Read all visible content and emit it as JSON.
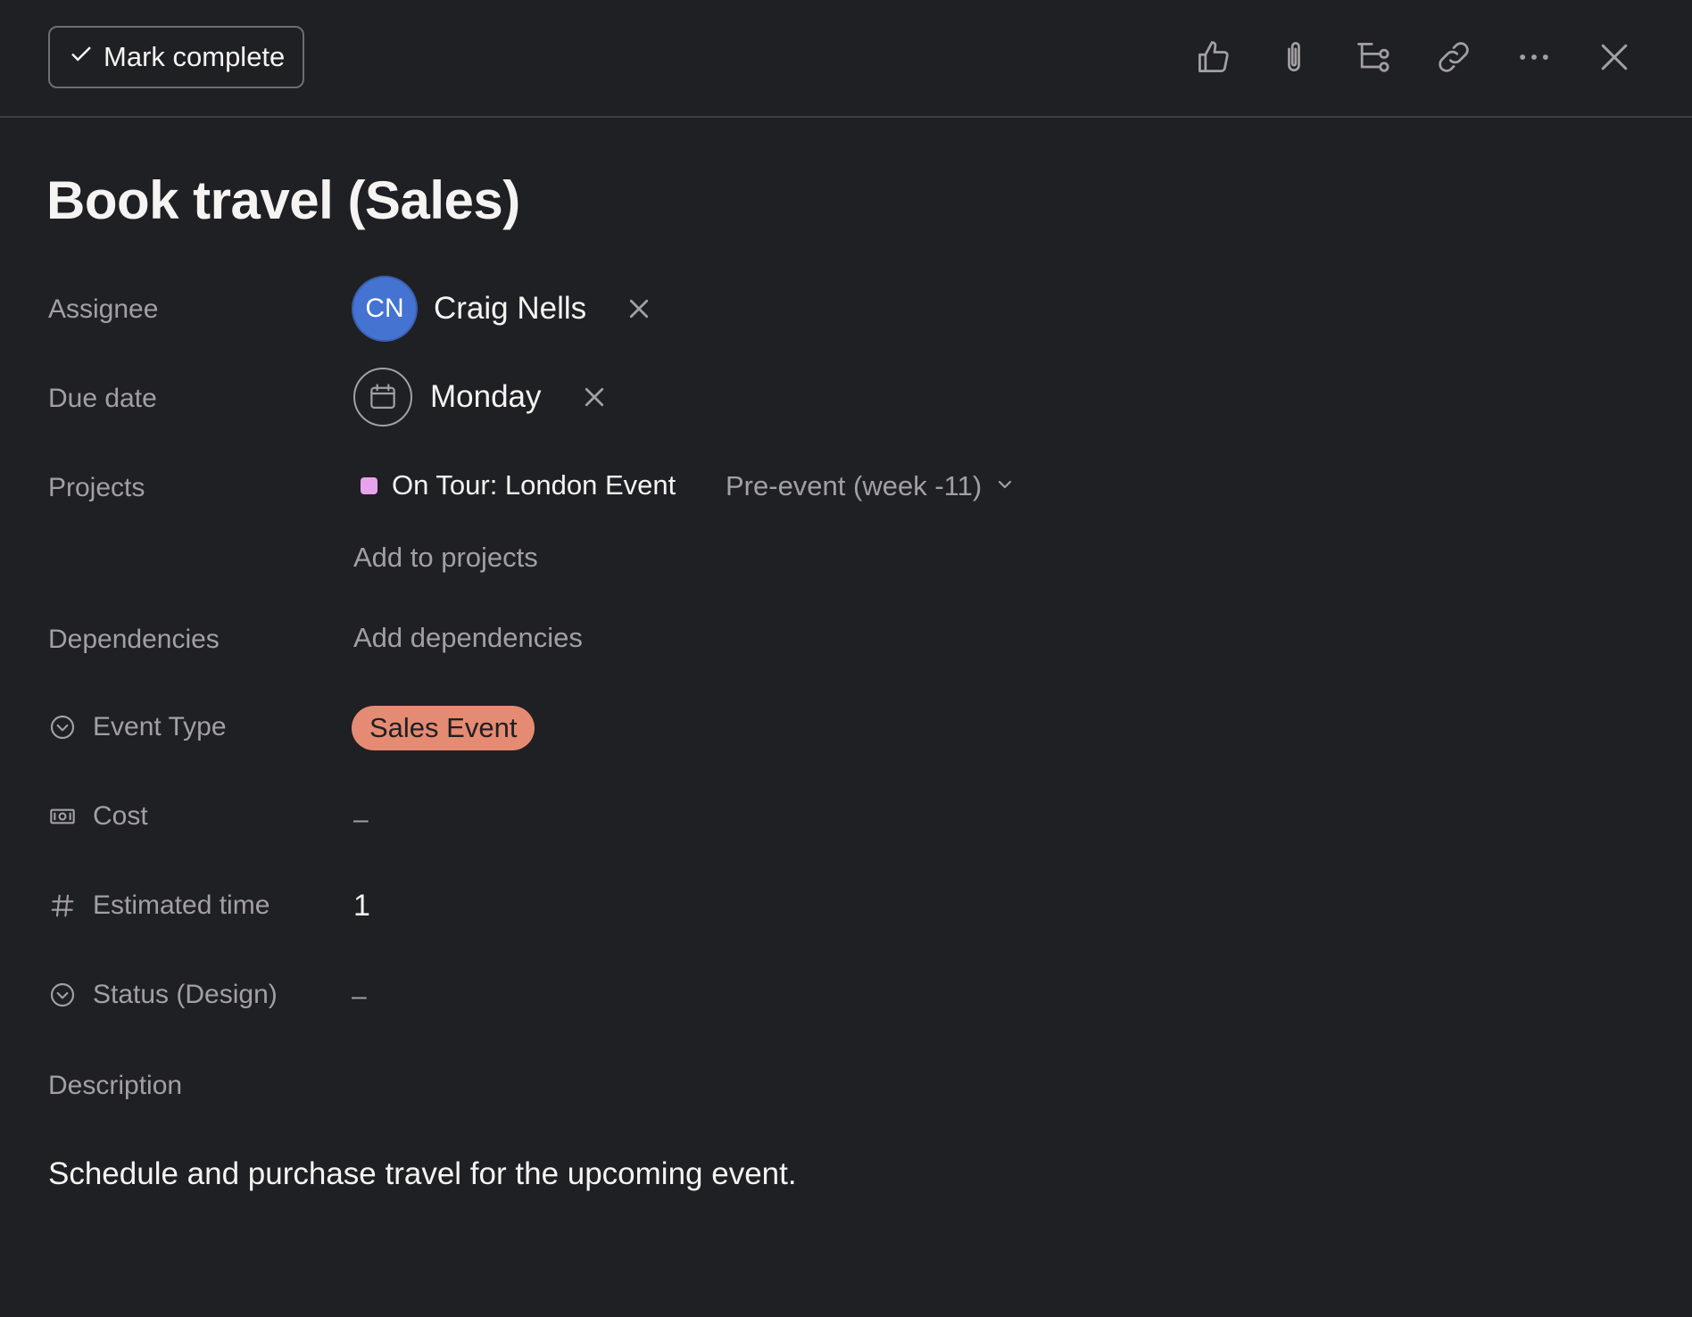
{
  "header": {
    "mark_complete_label": "Mark complete",
    "actions": [
      {
        "name": "like-icon"
      },
      {
        "name": "attachment-icon"
      },
      {
        "name": "subtask-icon"
      },
      {
        "name": "link-icon"
      },
      {
        "name": "more-icon"
      },
      {
        "name": "close-icon"
      }
    ]
  },
  "task": {
    "title": "Book travel (Sales)"
  },
  "fields": {
    "assignee": {
      "label": "Assignee",
      "initials": "CN",
      "name": "Craig Nells",
      "avatar_color": "#4573d2"
    },
    "due_date": {
      "label": "Due date",
      "value": "Monday"
    },
    "projects": {
      "label": "Projects",
      "project_name": "On Tour: London Event",
      "project_color": "#e7a3ec",
      "section": "Pre-event (week -11)",
      "add_label": "Add to projects"
    },
    "dependencies": {
      "label": "Dependencies",
      "add_label": "Add dependencies"
    },
    "event_type": {
      "label": "Event Type",
      "value": "Sales Event",
      "color": "#e58b73"
    },
    "cost": {
      "label": "Cost",
      "value": "–"
    },
    "estimated_time": {
      "label": "Estimated time",
      "value": "1"
    },
    "status_design": {
      "label": "Status (Design)",
      "value": "–"
    },
    "description": {
      "label": "Description",
      "text": "Schedule and purchase travel for the upcoming event."
    }
  },
  "colors": {
    "background": "#1f2023",
    "text": "#f5f4f3",
    "muted": "#a2a0a2"
  }
}
